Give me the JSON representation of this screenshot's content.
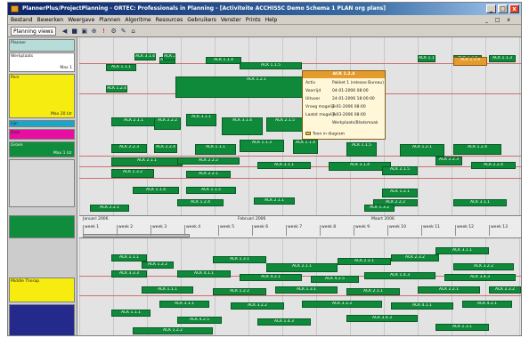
{
  "window": {
    "title": "PlannerPlus/ProjectPlanning - ORTEC: Professionals in Planning - [Activiteite ACCHISSC Demo Schema 1 PLAN  org plans]",
    "controls": {
      "minimize": "_",
      "maximize": "□",
      "close": "x"
    }
  },
  "menu": {
    "items": [
      "Bestand",
      "Bewerken",
      "Weergave",
      "Plannen",
      "Algoritme",
      "Resources",
      "Gebruikers",
      "Venster",
      "Prints",
      "Help"
    ],
    "mdi_controls": "_ □ x"
  },
  "toolbar": {
    "view_select": "Planning views",
    "buttons": [
      "◀",
      "■",
      "▣",
      "⊕",
      "!",
      "⚙",
      "✎",
      "⌂"
    ]
  },
  "left_panel": {
    "resources": [
      {
        "label": "Planner",
        "capacity": "",
        "color": "#b7ddd9"
      },
      {
        "label": "Werkplaats",
        "capacity": "Max 1",
        "color": "#ffffff"
      },
      {
        "label": "Pers",
        "capacity": "Max 20 Ltr",
        "color": "#f7ec10"
      },
      {
        "label": "Lijn",
        "capacity": "",
        "color": "#1aa6c8"
      },
      {
        "label": "Zaal",
        "capacity": "",
        "color": "#e80ea2"
      },
      {
        "label": "Groen",
        "capacity": "Max 1 Ltr",
        "color": "#0f8c3c"
      },
      {
        "label": "",
        "capacity": "",
        "color": "#d9d9d9"
      },
      {
        "label": "",
        "capacity": "",
        "color": "#0f8c3c"
      },
      {
        "label": "Middle Therap",
        "capacity": "",
        "color": "#f7ec10"
      },
      {
        "label": "",
        "capacity": "",
        "color": "#232a8c"
      }
    ]
  },
  "timeline": {
    "periods": [
      "Januari 2006",
      "Februari 2006",
      "Maart 2006"
    ],
    "weeks": [
      "week 1",
      "week 2",
      "week 3",
      "week 4",
      "week 5",
      "week 6",
      "week 7",
      "week 8",
      "week 9",
      "week 10",
      "week 11",
      "week 12",
      "week 13"
    ]
  },
  "activities_top": [
    "ACK 1.1.1",
    "ACK 1.1.3",
    "ACK 1.1.4",
    "ACK 1.1.5",
    "ACK 1.2.1",
    "ACK 1.2.4",
    "ACK 2.1.1",
    "ACK 2.2.2",
    "ACK 3.1.1",
    "ACK 3.1.4",
    "ACK 2.1.5",
    "ACK 1.3.2",
    "ACK 2.2.1",
    "ACK 2.2.3",
    "ACK 2.2.4",
    "ACK 3.3.4"
  ],
  "activities_bottom": [
    "ACK 1.1.1",
    "ACK 1.2.2",
    "ACK 1.3.1",
    "ACK 2.1.1",
    "ACK 2.2.1",
    "ACK 2.3.2",
    "ACK 3.1.1",
    "ACK 3.2.2",
    "ACK 3.3.3",
    "ACK 4.1.1",
    "ACK 4.2.1",
    "ACK 4.2.5",
    "ACK 1.4.3",
    "ACK 3.4.3"
  ],
  "popup": {
    "title": "ACK 1.2.4",
    "rows": [
      {
        "key": "Activ",
        "value": "Pakket 1 (release Bureau)"
      },
      {
        "key": "Voorrijd",
        "value": "04-01-2006 08:00"
      },
      {
        "key": "Uitvoer",
        "value": "24-01-2006 18:00:00"
      },
      {
        "key": "Vroeg mogelijk",
        "value": "7-01-2006 08:00"
      },
      {
        "key": "Laatst mogelijk",
        "value": "7-03-2006 08:00"
      },
      {
        "key": "",
        "value": "Werkplaats/Bladsmaak"
      }
    ],
    "link": "Toon in diagram"
  },
  "colors": {
    "activity": "#0e8a3a",
    "activity_selected": "#e59b2a",
    "title_bar": "#0a246a",
    "grid_bg": "#e3e3e3"
  }
}
